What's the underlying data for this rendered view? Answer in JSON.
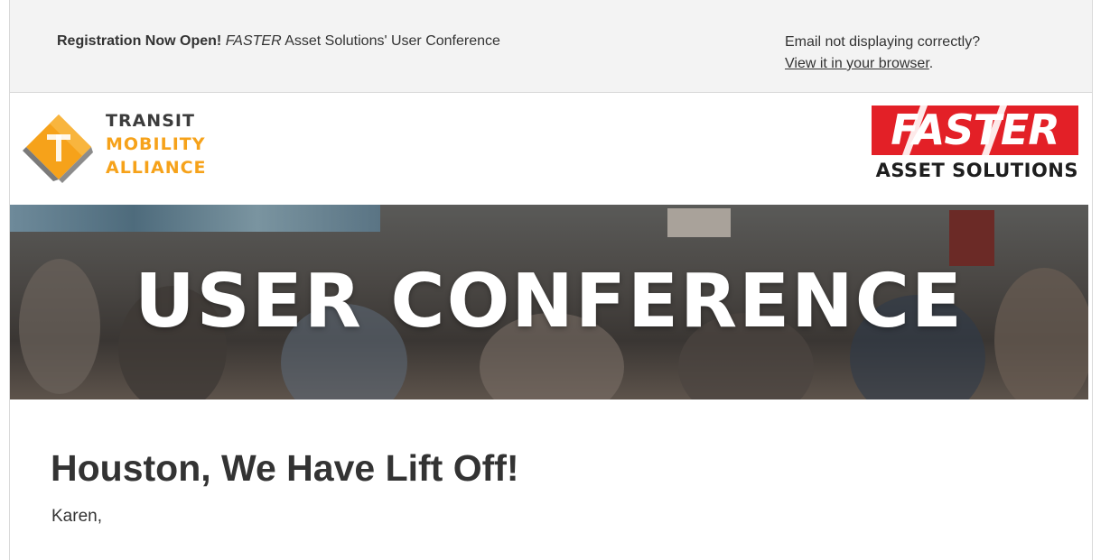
{
  "preheader": {
    "lead_bold": "Registration Now Open!",
    "lead_brand": "FASTER",
    "lead_rest": "Asset Solutions' User Conference",
    "notice": "Email not displaying correctly?",
    "browser_link": "View it in your browser",
    "browser_link_suffix": "."
  },
  "logos": {
    "partner": {
      "line1": "TRANSIT",
      "line2": "MOBILITY",
      "line3": "ALLIANCE",
      "icon": "transit-t-icon"
    },
    "brand": {
      "word": "FASTER",
      "subtitle": "ASSET SOLUTIONS"
    }
  },
  "banner": {
    "title": "USER CONFERENCE"
  },
  "content": {
    "headline": "Houston, We Have Lift Off!",
    "salutation": "Karen,"
  },
  "colors": {
    "brand_red": "#e32027",
    "partner_orange": "#f6a21a",
    "partner_gray": "#3c3c3c",
    "preheader_bg": "#f3f3f3"
  }
}
